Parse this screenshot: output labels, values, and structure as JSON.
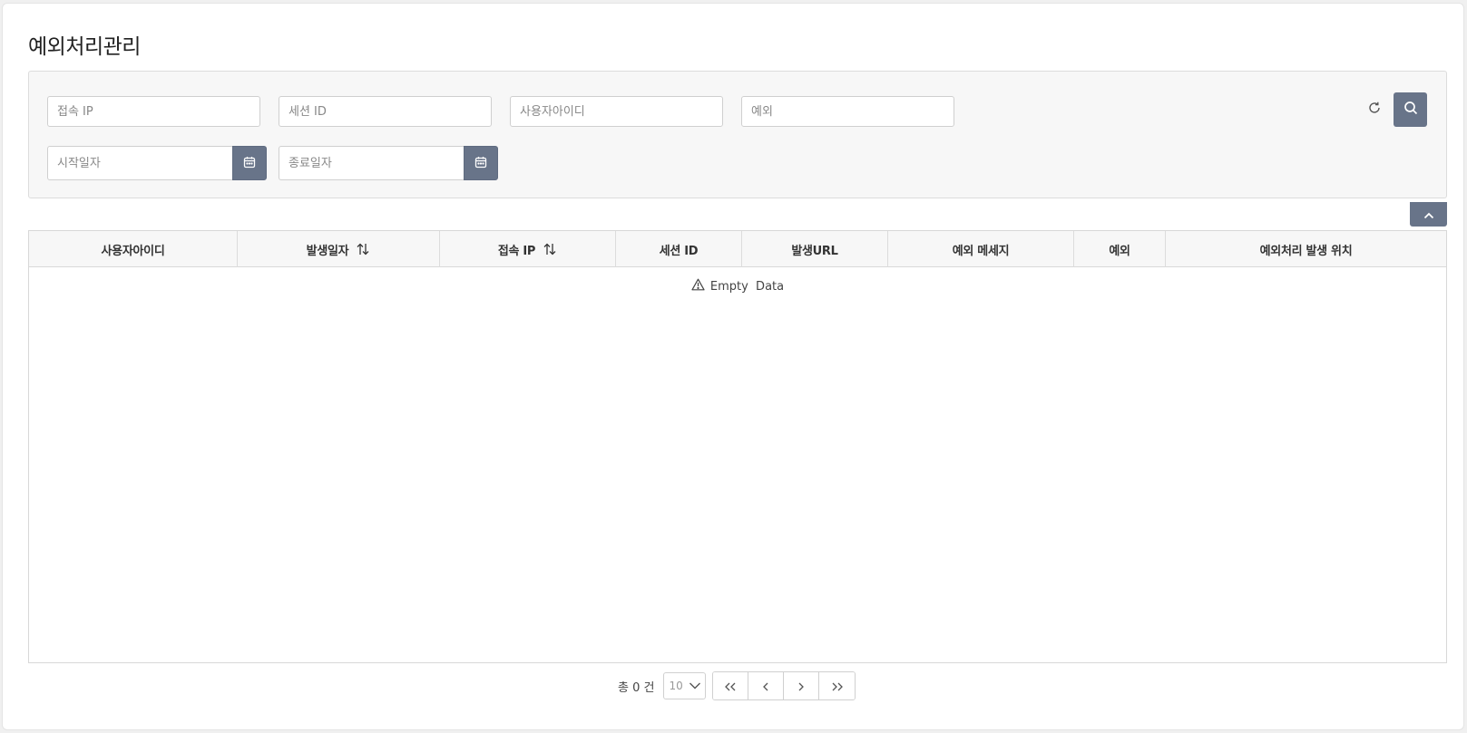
{
  "page": {
    "title": "예외처리관리"
  },
  "search": {
    "access_ip_placeholder": "접속 IP",
    "session_id_placeholder": "세션 ID",
    "user_id_placeholder": "사용자아이디",
    "exception_placeholder": "예외",
    "start_date_placeholder": "시작일자",
    "end_date_placeholder": "종료일자"
  },
  "grid": {
    "columns": [
      {
        "label": "사용자아이디",
        "sortable": false
      },
      {
        "label": "발생일자",
        "sortable": true
      },
      {
        "label": "접속 IP",
        "sortable": true
      },
      {
        "label": "세션 ID",
        "sortable": false
      },
      {
        "label": "발생URL",
        "sortable": false
      },
      {
        "label": "예외 메세지",
        "sortable": false
      },
      {
        "label": "예외",
        "sortable": false
      },
      {
        "label": "예외처리 발생 위치",
        "sortable": false
      }
    ],
    "empty_text": "Empty  Data"
  },
  "pagination": {
    "total_text": "총 0 건",
    "page_size": "10"
  },
  "icons": {
    "calendar": "calendar-icon",
    "refresh": "refresh-icon",
    "search": "search-icon",
    "collapse": "chevron-up-icon",
    "sort": "sort-icon",
    "warning": "warning-icon"
  },
  "colors": {
    "button": "#687489",
    "panel_bg": "#f7f7f7",
    "border": "#d8d8d8"
  }
}
